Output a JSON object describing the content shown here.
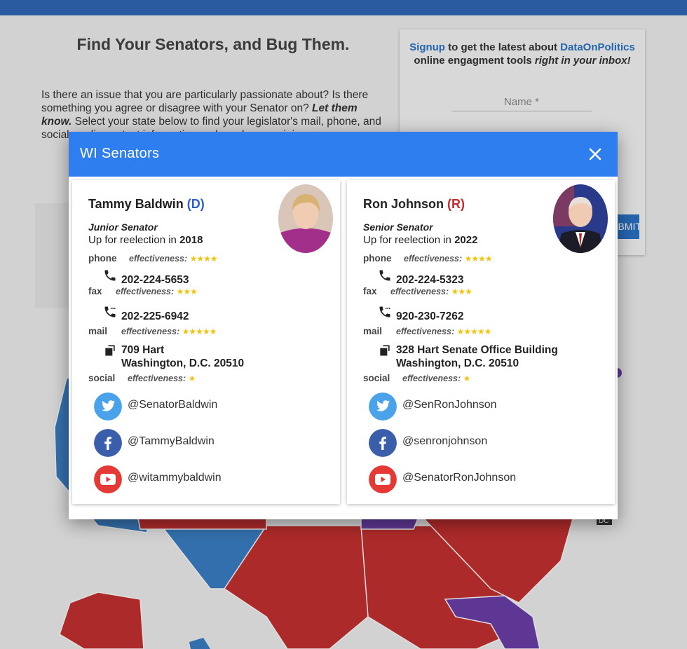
{
  "page": {
    "title": "Find Your Senators, and Bug Them.",
    "intro_text": "Is there an issue that you are particularly passionate about? Is there something you agree or disagree with your Senator on?",
    "intro_emphasis": "Let them know.",
    "intro_tail": "Select your state below to find your legislator's mail, phone, and social media contact information and send your opinions."
  },
  "signup": {
    "link_text": "Signup",
    "text_1": "to get the latest about",
    "brand": "DataOnPolitics",
    "text_2": "online engagment tools",
    "emphasis": "right in your inbox!",
    "name_placeholder": "Name *",
    "submit_label": "SUBMIT"
  },
  "modal": {
    "title": "WI Senators",
    "senators": [
      {
        "name": "Tammy Baldwin",
        "party": "(D)",
        "seniority": "Junior Senator",
        "reelection_label": "Up for reelection in",
        "reelection_year": "2018",
        "phone_label": "phone",
        "fax_label": "fax",
        "mail_label": "mail",
        "social_label": "social",
        "effectiveness_label": "effectiveness:",
        "phone_stars": "★★★★",
        "fax_stars": "★★★",
        "mail_stars": "★★★★★",
        "social_stars": "★",
        "phone": "202-224-5653",
        "fax": "202-225-6942",
        "address_1": "709 Hart",
        "address_2": "Washington, D.C. 20510",
        "twitter": "@SenatorBaldwin",
        "facebook": "@TammyBaldwin",
        "youtube": "@witammybaldwin"
      },
      {
        "name": "Ron Johnson",
        "party": "(R)",
        "seniority": "Senior Senator",
        "reelection_label": "Up for reelection in",
        "reelection_year": "2022",
        "phone_label": "phone",
        "fax_label": "fax",
        "mail_label": "mail",
        "social_label": "social",
        "effectiveness_label": "effectiveness:",
        "phone_stars": "★★★★",
        "fax_stars": "★★★",
        "mail_stars": "★★★★★",
        "social_stars": "★",
        "phone": "202-224-5323",
        "fax": "920-230-7262",
        "address_1": "328 Hart Senate Office Building",
        "address_2": "Washington, D.C. 20510",
        "twitter": "@SenRonJohnson",
        "facebook": "@senronjohnson",
        "youtube": "@SenatorRonJohnson"
      }
    ]
  },
  "map": {
    "dc_label": "DC",
    "colors": {
      "dem": "#3b7fc4",
      "rep": "#c53030",
      "split": "#6a3fa8"
    }
  },
  "colors": {
    "header": "#2f7ef0",
    "topbar": "#2a5aa0",
    "star": "#f1c40f"
  }
}
